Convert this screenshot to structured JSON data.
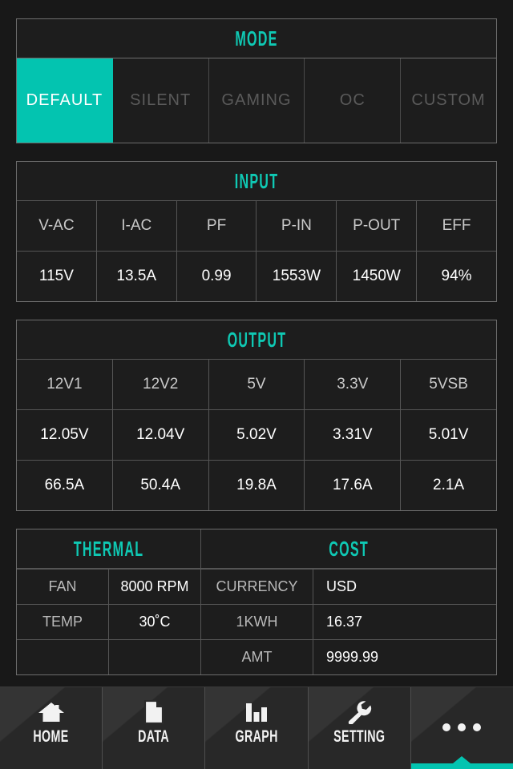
{
  "mode": {
    "title": "MODE",
    "options": [
      {
        "label": "DEFAULT",
        "active": true
      },
      {
        "label": "SILENT",
        "active": false
      },
      {
        "label": "GAMING",
        "active": false
      },
      {
        "label": "OC",
        "active": false
      },
      {
        "label": "CUSTOM",
        "active": false
      }
    ]
  },
  "input": {
    "title": "INPUT",
    "headers": [
      "V-AC",
      "I-AC",
      "PF",
      "P-IN",
      "P-OUT",
      "EFF"
    ],
    "values": [
      "115V",
      "13.5A",
      "0.99",
      "1553W",
      "1450W",
      "94%"
    ]
  },
  "output": {
    "title": "OUTPUT",
    "headers": [
      "12V1",
      "12V2",
      "5V",
      "3.3V",
      "5VSB"
    ],
    "voltages": [
      "12.05V",
      "12.04V",
      "5.02V",
      "3.31V",
      "5.01V"
    ],
    "currents": [
      "66.5A",
      "50.4A",
      "19.8A",
      "17.6A",
      "2.1A"
    ]
  },
  "thermal": {
    "title": "THERMAL",
    "rows": [
      {
        "label": "FAN",
        "value": "8000 RPM"
      },
      {
        "label": "TEMP",
        "value": "30˚C"
      },
      {
        "label": "",
        "value": ""
      }
    ]
  },
  "cost": {
    "title": "COST",
    "rows": [
      {
        "label": "CURRENCY",
        "value": "USD"
      },
      {
        "label": "1KWH",
        "value": "16.37"
      },
      {
        "label": "AMT",
        "value": "9999.99"
      }
    ]
  },
  "nav": {
    "items": [
      {
        "label": "HOME",
        "icon": "home-icon",
        "selected": false
      },
      {
        "label": "DATA",
        "icon": "document-icon",
        "selected": false
      },
      {
        "label": "GRAPH",
        "icon": "bar-chart-icon",
        "selected": false
      },
      {
        "label": "SETTING",
        "icon": "wrench-icon",
        "selected": false
      },
      {
        "label": "",
        "icon": "more-dots-icon",
        "selected": true
      }
    ]
  },
  "colors": {
    "accent": "#03c4b0",
    "background": "#181818",
    "panel": "#1d1d1d",
    "border": "#6d6d6d",
    "text": "#ffffff",
    "muted": "#b9b9b9",
    "disabled": "#5a5a5a"
  }
}
